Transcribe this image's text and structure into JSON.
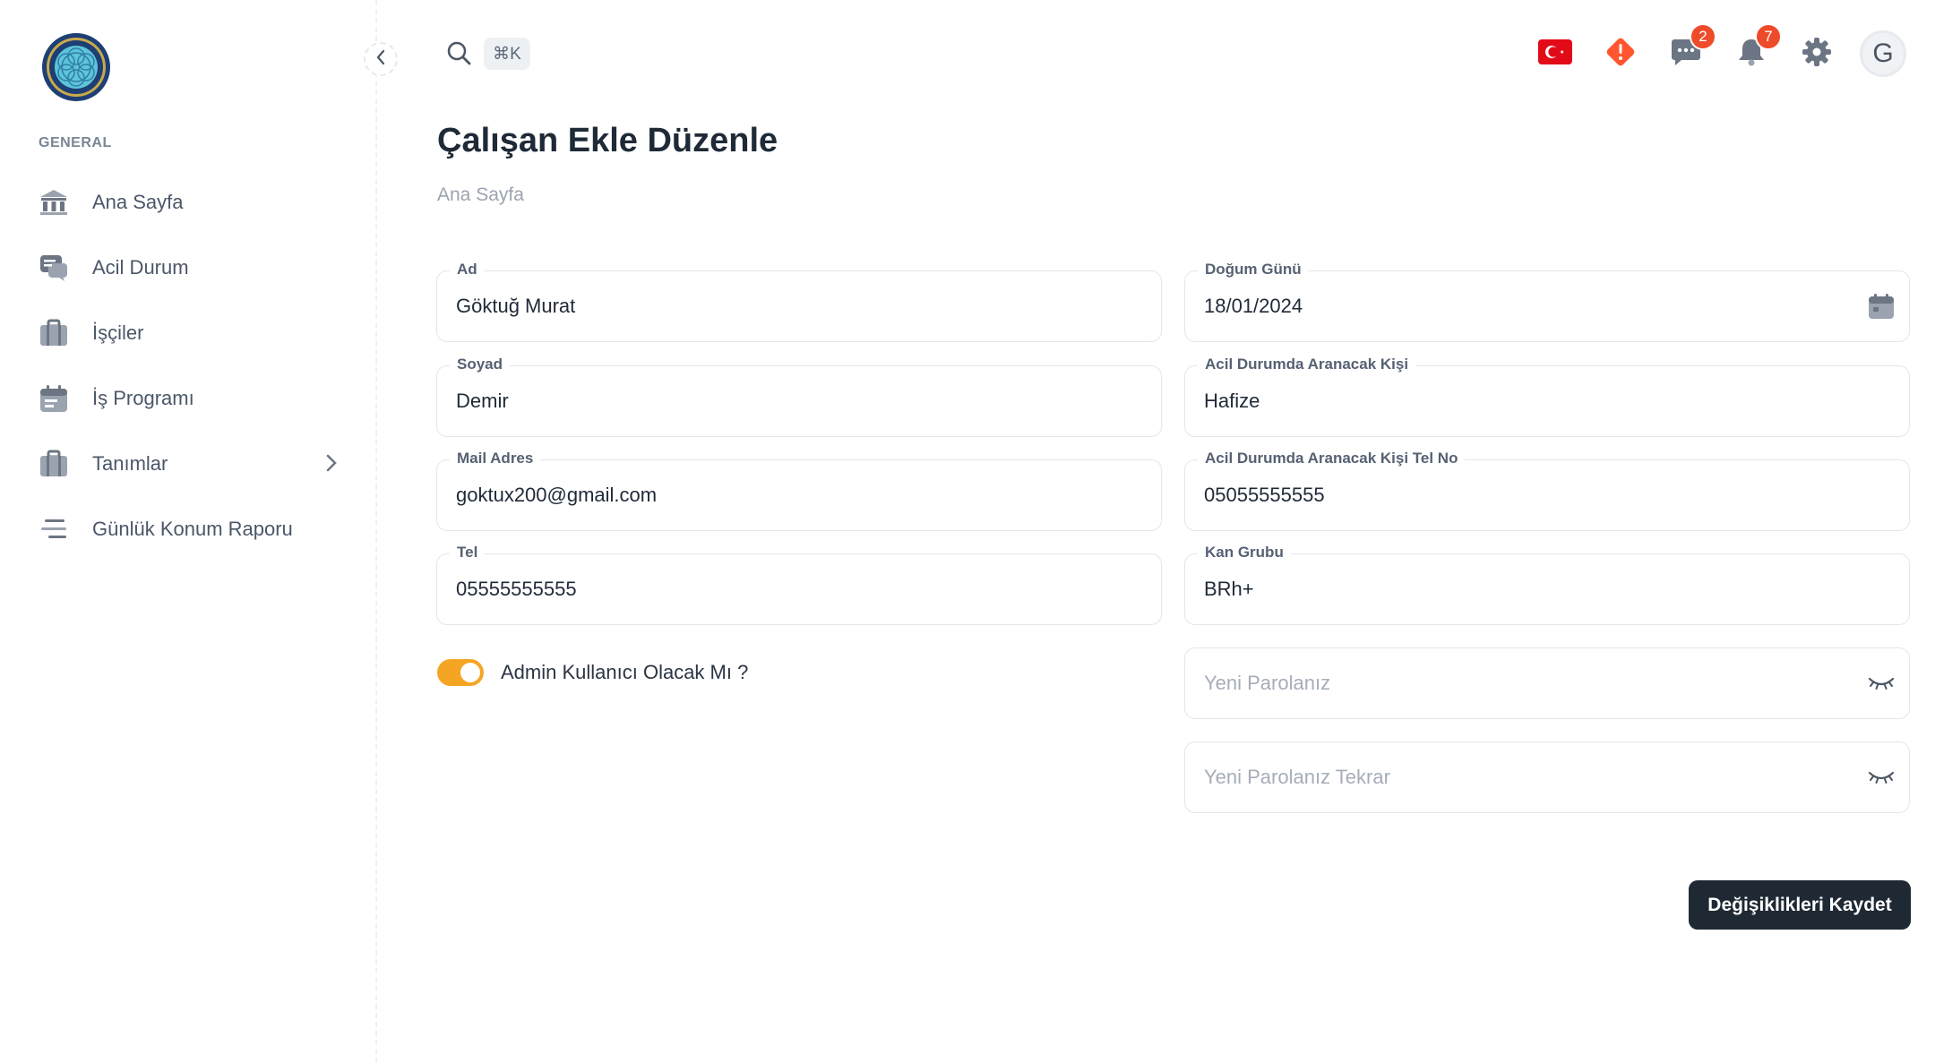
{
  "sidebar": {
    "section_label": "GENERAL",
    "items": [
      {
        "label": "Ana Sayfa",
        "icon": "bank-icon"
      },
      {
        "label": "Acil Durum",
        "icon": "chat-icon"
      },
      {
        "label": "İşçiler",
        "icon": "briefcase-icon"
      },
      {
        "label": "İş Programı",
        "icon": "calendar-icon"
      },
      {
        "label": "Tanımlar",
        "icon": "briefcase-icon",
        "has_submenu": true
      },
      {
        "label": "Günlük Konum Raporu",
        "icon": "lines-icon"
      }
    ]
  },
  "topbar": {
    "search_shortcut": "⌘K",
    "messages_badge": "2",
    "notifications_badge": "7",
    "avatar_initial": "G",
    "language_icon": "turkey-flag-icon"
  },
  "page": {
    "title": "Çalışan Ekle Düzenle",
    "breadcrumb": "Ana Sayfa"
  },
  "form": {
    "ad": {
      "label": "Ad",
      "value": "Göktuğ Murat"
    },
    "soyad": {
      "label": "Soyad",
      "value": "Demir"
    },
    "mail": {
      "label": "Mail Adres",
      "value": "goktux200@gmail.com"
    },
    "tel": {
      "label": "Tel",
      "value": "05555555555"
    },
    "dogum": {
      "label": "Doğum Günü",
      "value": "18/01/2024"
    },
    "acil_kisi": {
      "label": "Acil Durumda Aranacak Kişi",
      "value": "Hafize"
    },
    "acil_tel": {
      "label": "Acil Durumda Aranacak Kişi Tel No",
      "value": "05055555555"
    },
    "kan": {
      "label": "Kan Grubu",
      "value": "BRh+"
    },
    "parola": {
      "placeholder": "Yeni Parolanız"
    },
    "parola_tekrar": {
      "placeholder": "Yeni Parolanız Tekrar"
    },
    "admin_toggle": {
      "label": "Admin Kullanıcı Olacak Mı ?",
      "checked": true
    },
    "save_label": "Değişiklikleri Kaydet"
  },
  "colors": {
    "accent": "#f5a524",
    "button": "#1f2933",
    "badge": "#ee4b2b"
  }
}
